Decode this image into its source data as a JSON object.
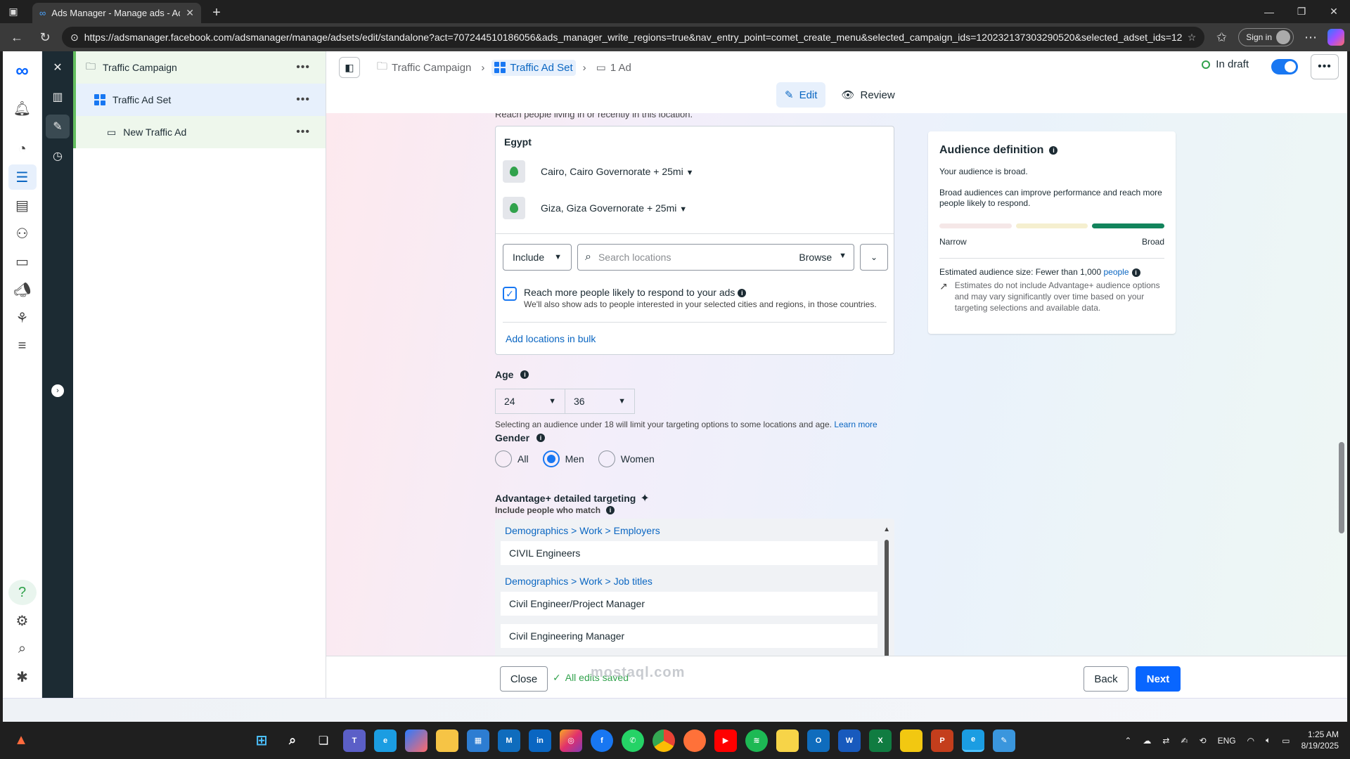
{
  "browser": {
    "tab_title": "Ads Manager - Manage ads - Ad",
    "url": "https://adsmanager.facebook.com/adsmanager/manage/adsets/edit/standalone?act=707244510186056&ads_manager_write_regions=true&nav_entry_point=comet_create_menu&selected_campaign_ids=120232137303290520&selected_adset_ids=120...",
    "signin_label": "Sign in"
  },
  "tree": {
    "campaign": "Traffic Campaign",
    "adset": "Traffic Ad Set",
    "ad": "New Traffic Ad"
  },
  "topbar": {
    "crumb_campaign": "Traffic Campaign",
    "crumb_adset": "Traffic Ad Set",
    "crumb_ad": "1 Ad",
    "draft_status": "In draft",
    "edit_tab": "Edit",
    "review_tab": "Review"
  },
  "location": {
    "cut_text": "Reach people living in or recently in this location.",
    "country": "Egypt",
    "items": [
      {
        "label": "Cairo, Cairo Governorate + 25mi"
      },
      {
        "label": "Giza, Giza Governorate + 25mi"
      }
    ],
    "include_label": "Include",
    "search_placeholder": "Search locations",
    "browse_label": "Browse",
    "reach_more_title": "Reach more people likely to respond to your ads",
    "reach_more_desc": "We'll also show ads to people interested in your selected cities and regions, in those countries.",
    "bulk_link": "Add locations in bulk"
  },
  "age": {
    "label": "Age",
    "min": "24",
    "max": "36",
    "note": "Selecting an audience under 18 will limit your targeting options to some locations and age.",
    "learn_more": "Learn more"
  },
  "gender": {
    "label": "Gender",
    "options": [
      "All",
      "Men",
      "Women"
    ],
    "selected": "Men"
  },
  "targeting": {
    "title": "Advantage+ detailed targeting",
    "sublabel": "Include people who match",
    "groups": [
      {
        "path": [
          "Demographics",
          "Work",
          "Employers"
        ],
        "items": [
          "CIVIL Engineers"
        ]
      },
      {
        "path": [
          "Demographics",
          "Work",
          "Job titles"
        ],
        "items": [
          "Civil Engineer/Project Manager",
          "Civil Engineering Manager"
        ]
      }
    ]
  },
  "audience": {
    "title": "Audience definition",
    "status": "Your audience is broad.",
    "desc": "Broad audiences can improve performance and reach more people likely to respond.",
    "narrow": "Narrow",
    "broad": "Broad",
    "est_prefix": "Estimated audience size: Fewer than 1,000",
    "est_link": "people",
    "est_note": "Estimates do not include Advantage+ audience options and may vary significantly over time based on your targeting selections and available data.",
    "meter_colors": [
      "#f5e7e7",
      "#f5efcf",
      "#12845c"
    ]
  },
  "footer": {
    "close": "Close",
    "saved": "All edits saved",
    "back": "Back",
    "next": "Next"
  },
  "taskbar": {
    "lang": "ENG",
    "time": "1:25 AM",
    "date": "8/19/2025"
  },
  "watermark": "mostaql.com"
}
